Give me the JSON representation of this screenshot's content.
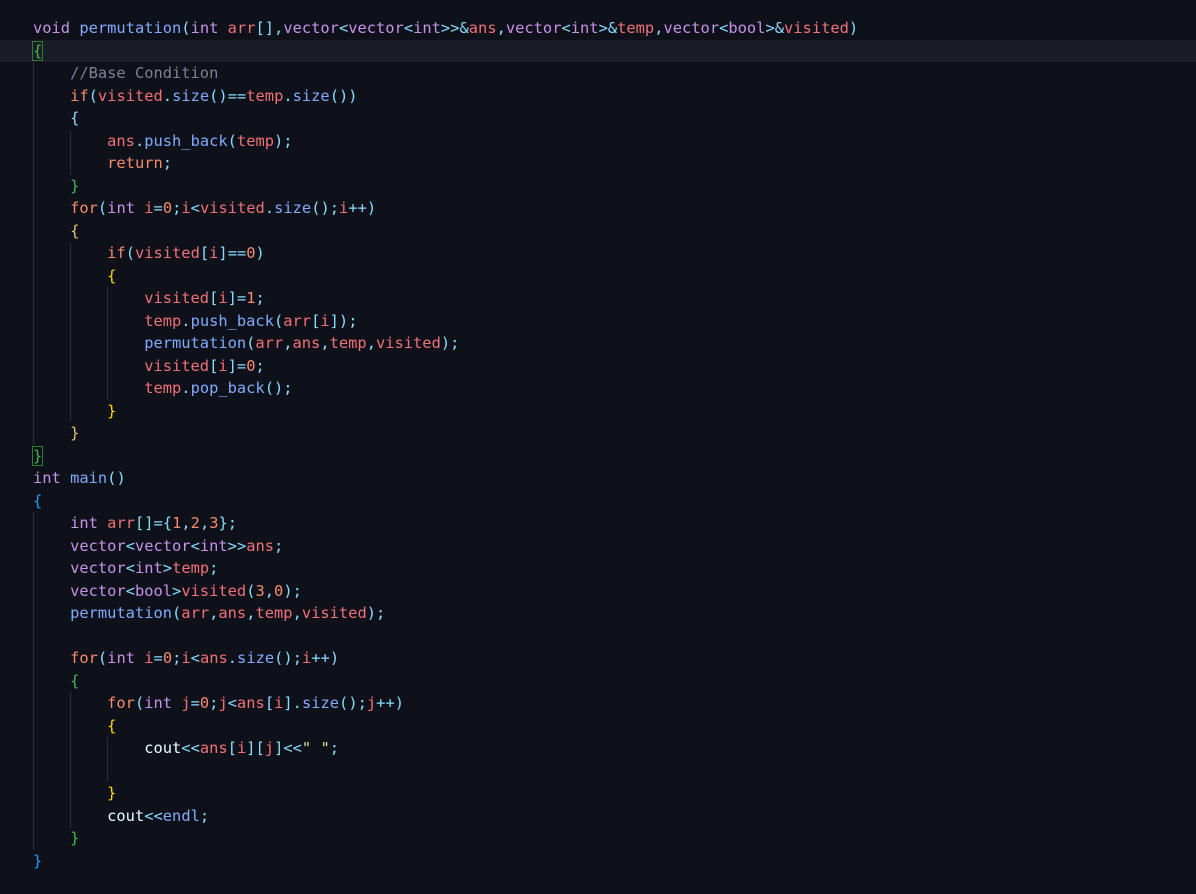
{
  "editor": {
    "theme_colors": {
      "background": "#0f111a",
      "keyword": "#c792ea",
      "function": "#82aaff",
      "variable": "#f07178",
      "number": "#f78c6c",
      "comment": "#7c8394",
      "string": "#c3e88d"
    },
    "code_lines": [
      "void permutation(int arr[],vector<vector<int>>&ans,vector<int>&temp,vector<bool>&visited)",
      "{",
      "    //Base Condition",
      "    if(visited.size()==temp.size())",
      "    {",
      "        ans.push_back(temp);",
      "        return;",
      "    }",
      "    for(int i=0;i<visited.size();i++)",
      "    {",
      "        if(visited[i]==0)",
      "        {",
      "            visited[i]=1;",
      "            temp.push_back(arr[i]);",
      "            permutation(arr,ans,temp,visited);",
      "            visited[i]=0;",
      "            temp.pop_back();",
      "        }",
      "    }",
      "}",
      "int main()",
      "{",
      "    int arr[]={1,2,3};",
      "    vector<vector<int>>ans;",
      "    vector<int>temp;",
      "    vector<bool>visited(3,0);",
      "    permutation(arr,ans,temp,visited);",
      "",
      "    for(int i=0;i<ans.size();i++)",
      "    {",
      "        for(int j=0;j<ans[i].size();j++)",
      "        {",
      "            cout<<ans[i][j]<<\" \";",
      "",
      "        }",
      "        cout<<endl;",
      "    }",
      "}"
    ]
  }
}
